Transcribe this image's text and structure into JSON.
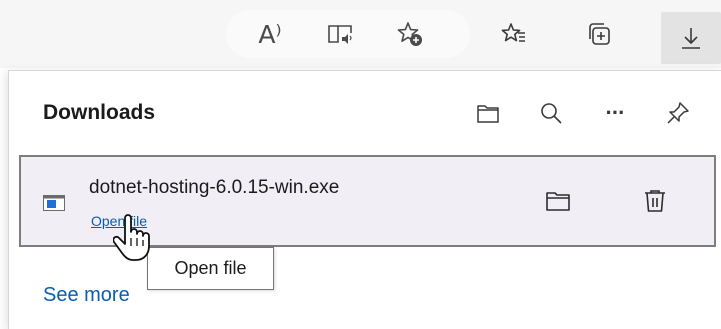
{
  "toolbar": {
    "buttons": [
      {
        "name": "read-aloud-icon",
        "label": "A⁾"
      },
      {
        "name": "immersive-reader-icon"
      },
      {
        "name": "add-favorite-icon"
      },
      {
        "name": "favorites-icon"
      },
      {
        "name": "collections-icon"
      },
      {
        "name": "downloads-icon",
        "active": true
      }
    ]
  },
  "downloads": {
    "title": "Downloads",
    "header_actions": [
      "open-folder-icon",
      "search-icon",
      "more-icon",
      "pin-icon"
    ],
    "more_label": "···",
    "item": {
      "filename": "dotnet-hosting-6.0.15-win.exe",
      "open_link": "Open file",
      "actions": [
        "show-in-folder-icon",
        "delete-icon"
      ]
    },
    "see_more": "See more"
  },
  "tooltip": {
    "text": "Open file"
  },
  "colors": {
    "toolbar_bg": "#f6f6f6",
    "active_button_bg": "#e3e3e3",
    "item_bg": "#f1eff5",
    "item_border": "#7d7d7d",
    "link": "#0b5cad",
    "text": "#1b1b1b"
  }
}
